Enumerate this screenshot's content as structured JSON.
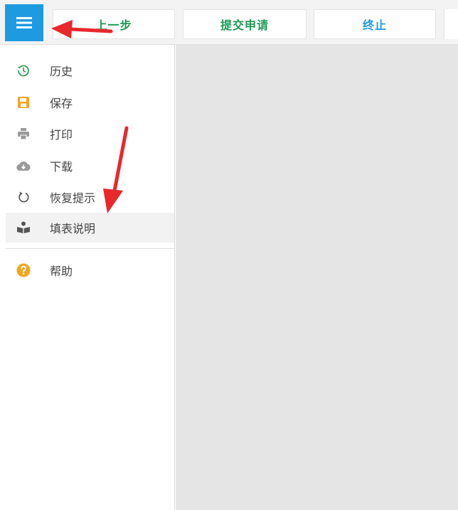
{
  "toolbar": {
    "menu_icon": "hamburger-menu-icon",
    "prev_label": "上一步",
    "submit_label": "提交申请",
    "stop_label": "终止"
  },
  "sidebar": {
    "items": [
      {
        "label": "历史",
        "icon": "history-icon",
        "icon_color": "#3aa05b"
      },
      {
        "label": "保存",
        "icon": "save-icon",
        "icon_color": "#f3a521"
      },
      {
        "label": "打印",
        "icon": "print-icon",
        "icon_color": "#9a9a9a"
      },
      {
        "label": "下载",
        "icon": "cloud-download-icon",
        "icon_color": "#9a9a9a"
      },
      {
        "label": "恢复提示",
        "icon": "restore-icon",
        "icon_color": "#555555"
      },
      {
        "label": "填表说明",
        "icon": "book-reader-icon",
        "icon_color": "#555555"
      },
      {
        "label": "帮助",
        "icon": "help-icon",
        "icon_color": "#f3a521"
      }
    ]
  },
  "colors": {
    "accent_blue": "#1e9be0",
    "accent_green": "#1c9a55",
    "annotation_red": "#e8282b",
    "content_bg": "#e5e5e5"
  }
}
